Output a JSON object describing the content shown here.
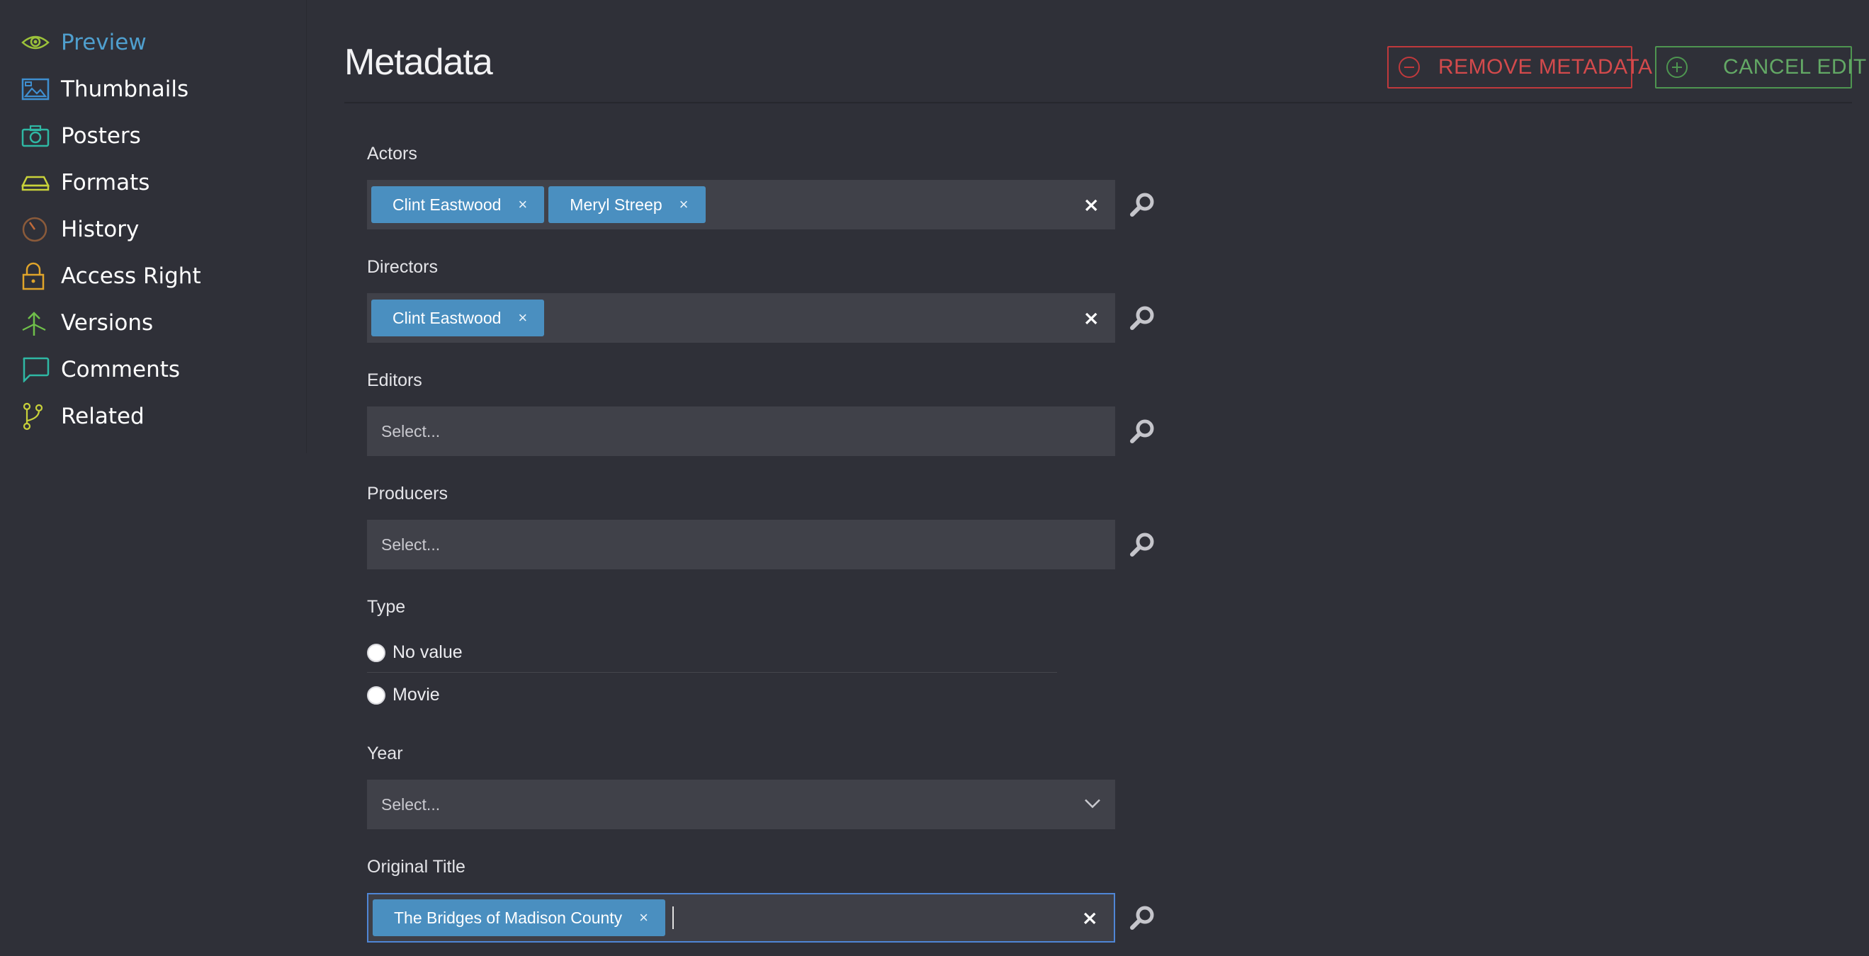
{
  "sidebar": {
    "items": [
      {
        "label": "Preview",
        "icon": "eye-icon",
        "active": true
      },
      {
        "label": "Thumbnails",
        "icon": "image-icon"
      },
      {
        "label": "Posters",
        "icon": "camera-icon"
      },
      {
        "label": "Formats",
        "icon": "stack-icon"
      },
      {
        "label": "History",
        "icon": "clock-icon"
      },
      {
        "label": "Access Right",
        "icon": "lock-icon"
      },
      {
        "label": "Versions",
        "icon": "upload-icon"
      },
      {
        "label": "Comments",
        "icon": "speech-bubble-icon"
      },
      {
        "label": "Related",
        "icon": "branch-icon"
      }
    ]
  },
  "header": {
    "title": "Metadata",
    "remove_label": "REMOVE METADATA",
    "cancel_label": "CANCEL EDIT"
  },
  "form": {
    "actors": {
      "label": "Actors",
      "tags": [
        "Clint Eastwood",
        "Meryl Streep"
      ]
    },
    "directors": {
      "label": "Directors",
      "tags": [
        "Clint Eastwood"
      ]
    },
    "editors": {
      "label": "Editors",
      "placeholder": "Select..."
    },
    "producers": {
      "label": "Producers",
      "placeholder": "Select..."
    },
    "type": {
      "label": "Type",
      "options": [
        "No value",
        "Movie"
      ]
    },
    "year": {
      "label": "Year",
      "placeholder": "Select..."
    },
    "original_title": {
      "label": "Original Title",
      "tags": [
        "The Bridges of Madison County"
      ]
    },
    "tag_remove_glyph": "×",
    "clear_glyph": "×"
  },
  "colors": {
    "background": "#2f3038",
    "accent_blue": "#4f9fce",
    "tag_blue": "#4a8fc0",
    "danger": "#d34a4c",
    "success": "#63a865"
  }
}
